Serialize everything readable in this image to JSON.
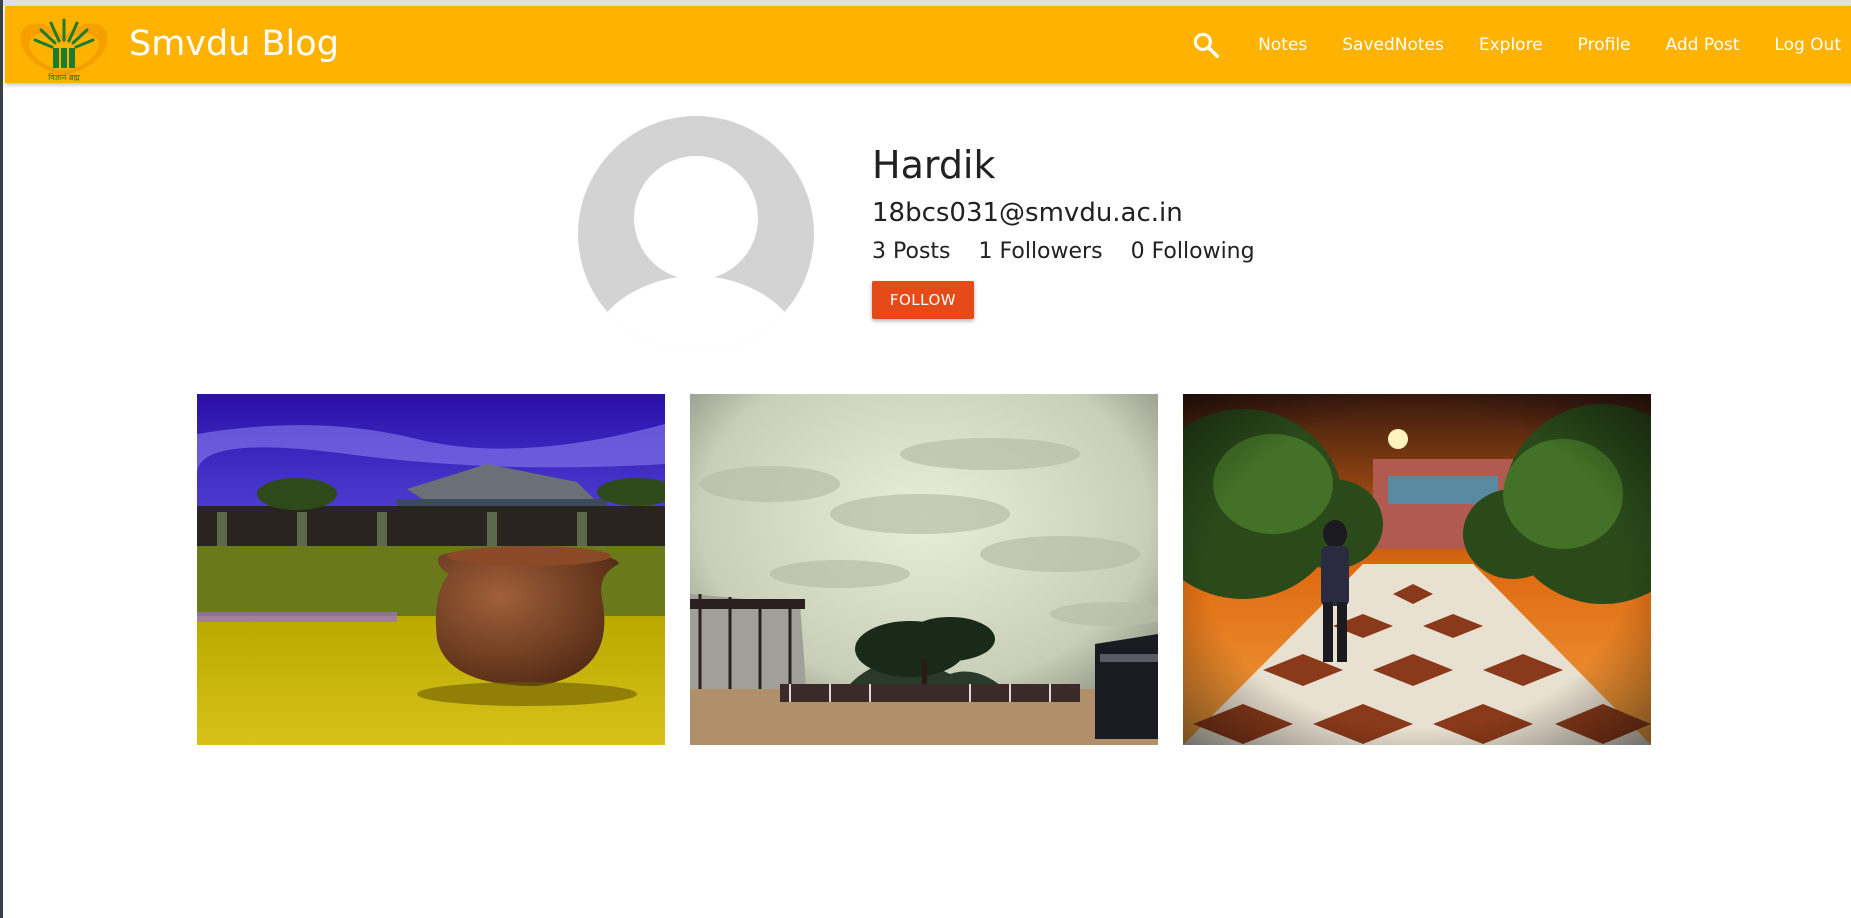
{
  "navbar": {
    "brand": "Smvdu Blog",
    "logo_tagline": "विज्ञानं ब्रह्म",
    "links": [
      "Notes",
      "SavedNotes",
      "Explore",
      "Profile",
      "Add Post",
      "Log Out"
    ],
    "color": "#ffb300"
  },
  "profile": {
    "name": "Hardik",
    "email": "18bcs031@smvdu.ac.in",
    "posts_count": "3",
    "posts_label": "Posts",
    "followers_count": "1",
    "followers_label": "Followers",
    "following_count": "0",
    "following_label": "Following",
    "follow_label": "FOLLOW",
    "follow_color": "#e64a19"
  },
  "posts": [
    {
      "name": "post-clay-pot"
    },
    {
      "name": "post-cloudy-sky"
    },
    {
      "name": "post-campus-walkway"
    }
  ]
}
